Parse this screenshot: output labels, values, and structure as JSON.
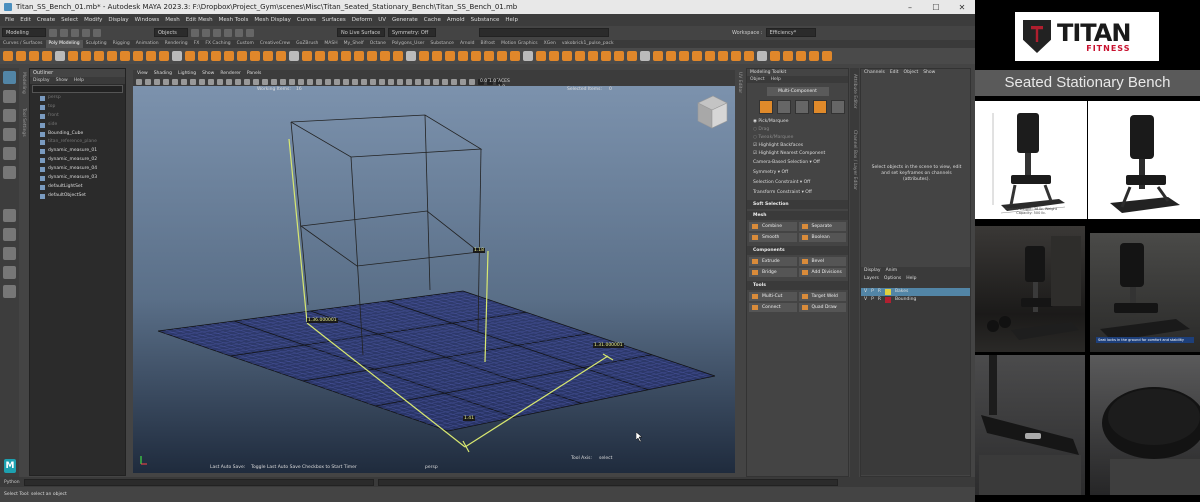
{
  "window": {
    "title": "Titan_SS_Bench_01.mb* - Autodesk MAYA 2023.3: F:\\Dropbox\\Project_Gym\\scenes\\Misc\\Titan_Seated_Stationary_Bench\\Titan_SS_Bench_01.mb",
    "minimize": "–",
    "maximize": "☐",
    "close": "✕"
  },
  "menu": [
    "File",
    "Edit",
    "Create",
    "Select",
    "Modify",
    "Display",
    "Windows",
    "Mesh",
    "Edit Mesh",
    "Mesh Tools",
    "Mesh Display",
    "Curves",
    "Surfaces",
    "Deform",
    "UV",
    "Generate",
    "Cache",
    "Arnold",
    "Substance",
    "Help"
  ],
  "status": {
    "mode": "Modeling",
    "objects": "Objects",
    "surface": "No Live Surface",
    "symmetry": "Symmetry: Off",
    "workspace_label": "Workspace :",
    "workspace": "Efficiency*"
  },
  "shelf_tabs": [
    "Curves / Surfaces",
    "Poly Modeling",
    "Sculpting",
    "Rigging",
    "Animation",
    "Rendering",
    "FX",
    "FX Caching",
    "Custom",
    "CreativeCrew",
    "GoZBrush",
    "MASH",
    "My_Shelf",
    "Octane",
    "Polygons_User",
    "Substance",
    "Arnold",
    "Bifrost",
    "Motion Graphics",
    "XGen",
    "vakobrick1_pulse_pack"
  ],
  "shelf_active": 1,
  "outliner": {
    "title": "Outliner",
    "menu": [
      "Display",
      "Show",
      "Help"
    ],
    "items": [
      {
        "label": "persp",
        "dim": true
      },
      {
        "label": "top",
        "dim": true
      },
      {
        "label": "front",
        "dim": true
      },
      {
        "label": "side",
        "dim": true
      },
      {
        "label": "Bounding_Cube",
        "dim": false
      },
      {
        "label": "titan_reference_plane",
        "dim": true
      },
      {
        "label": "dynamic_measure_01",
        "dim": false
      },
      {
        "label": "dynamic_measure_02",
        "dim": false
      },
      {
        "label": "dynamic_measure_04",
        "dim": false
      },
      {
        "label": "dynamic_measure_03",
        "dim": false
      },
      {
        "label": "defaultLightSet",
        "dim": false
      },
      {
        "label": "defaultObjectSet",
        "dim": false
      }
    ]
  },
  "viewport": {
    "menu": [
      "View",
      "Shading",
      "Lighting",
      "Show",
      "Renderer",
      "Panels"
    ],
    "exposure": "0.00",
    "gamma": "1.00",
    "colorspace": "ACES 1.0 SDR-video (sRGB)",
    "working_items_label": "Working Items:",
    "working_items_value": "16",
    "selected_items_label": "Selected Items:",
    "selected_items_value": "0",
    "measures": {
      "m1": "1.36.000001",
      "m2": "1.18",
      "m3": "1.31.000001",
      "m4": "1.41"
    },
    "autosave_label": "Last Auto Save:",
    "autosave_msg": "Toggle Last Auto Save Checkbox to Start Timer",
    "camera": "persp",
    "tool_axis_label": "Tool Axis:",
    "tool_axis_value": "select"
  },
  "modeling_toolkit": {
    "title": "Modeling Toolkit",
    "menu": [
      "Object",
      "Help"
    ],
    "multi_component": "Multi-Component",
    "options": [
      {
        "label": "Pick/Marquee",
        "dim": false
      },
      {
        "label": "Drag",
        "dim": true
      },
      {
        "label": "Tweak/Marquee",
        "dim": true
      },
      {
        "label": "Highlight Backfaces",
        "dim": false
      },
      {
        "label": "Highlight Nearest Component",
        "dim": false
      }
    ],
    "camera_based": "Camera-Based Selection  ▾  Off",
    "symmetry": "Symmetry  ▾  Off",
    "selection_constraint": "Selection Constraint  ▾  Off",
    "transform_constraint": "Transform Constraint  ▾  Off",
    "soft_selection": "Soft Selection",
    "mesh_section": "Mesh",
    "mesh_buttons": [
      "Combine",
      "Separate",
      "Smooth",
      "Boolean"
    ],
    "components_section": "Components",
    "component_buttons": [
      "Extrude",
      "Bevel",
      "Bridge",
      "Add Divisions"
    ],
    "tools_section": "Tools",
    "tool_buttons": [
      "Multi-Cut",
      "Target Weld",
      "Connect",
      "Quad Draw"
    ]
  },
  "channel_box": {
    "menu": [
      "Channels",
      "Edit",
      "Object",
      "Show"
    ],
    "message": "Select objects in the scene to view, edit and set keyframes on channels (attributes).",
    "layer_tabs": [
      "Display",
      "Anim"
    ],
    "layer_menu": [
      "Layers",
      "Options",
      "Help"
    ],
    "layers": [
      {
        "v": "V",
        "p": "P",
        "r": "R",
        "name": "Bakes",
        "color": "#e0d040",
        "selected": true
      },
      {
        "v": "V",
        "p": "P",
        "r": "R",
        "name": "Bounding",
        "color": "#b02030",
        "selected": false
      }
    ]
  },
  "command": {
    "label": "Python"
  },
  "help_line": "Select Tool: select an object",
  "maya_logo": "M",
  "reference": {
    "logo_titan": "TITAN",
    "logo_fitness": "FITNESS",
    "product_title": "Seated Stationary Bench",
    "thumb1_caption": "Product Weight: 38 lb. Weight Capacity: 500 lb.",
    "thumb4_tip": "Seat locks in the ground for comfort and stability"
  },
  "colors": {
    "accent": "#e0872a",
    "selection": "#5285a6",
    "measure": "#d8e870",
    "grid": "#2a3470"
  }
}
